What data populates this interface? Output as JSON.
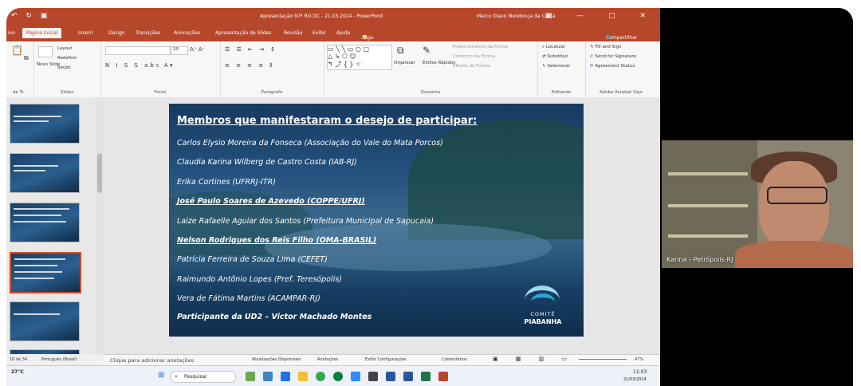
{
  "window": {
    "title": "Apresentação 97ª RO DC - 21.03.2024 - PowerPoint",
    "user": "Marco Olavo Mendonça da Costa",
    "search_hint": "Diga-me o que você deseja fazer",
    "share": "Compartilhar"
  },
  "tabs": [
    "ivo",
    "Página Inicial",
    "Inserir",
    "Design",
    "Transições",
    "Animações",
    "Apresentação de Slides",
    "Revisão",
    "Exibir",
    "Ajuda"
  ],
  "ribbon": {
    "groups": {
      "clipboard": "de Tr...",
      "slides": "Slides",
      "font": "Fonte",
      "paragraph": "Parágrafo",
      "drawing": "Desenho",
      "editing": "Editando",
      "acrobat": "Adobe Acrobat Sign"
    },
    "layout": "Layout",
    "reset": "Redefinir",
    "new_slide": "Novo Slide",
    "section": "Seção",
    "font_size": "20",
    "organize": "Organizar",
    "quick_styles": "Estilos Rápidos",
    "shape_fill": "Preenchimento da Forma",
    "shape_outline": "Contorno da Forma",
    "shape_effects": "Efeitos de Forma",
    "find": "Localizar",
    "replace": "Substituir",
    "select": "Selecionar",
    "fill_sign": "Fill and Sign",
    "send_sig": "Send for Signature",
    "agreement": "Agreement Status"
  },
  "slide": {
    "title": "Membros que manifestaram o desejo de participar:",
    "members": [
      {
        "text": "Carlos Elysio Moreira da Fonseca (Associação do Vale do Mata Porcos)",
        "bold": false,
        "underline": false
      },
      {
        "text": "Claudia Karina Wilberg de Castro Costa (IAB-RJ)",
        "bold": false,
        "underline": false
      },
      {
        "text": "Erika Cortines (UFRRJ-ITR)",
        "bold": false,
        "underline": false
      },
      {
        "text": "José Paulo Soares de Azevedo (COPPE/UFRJ)",
        "bold": true,
        "underline": true
      },
      {
        "text": "Laize Rafaelle Aguiar dos Santos (Prefeitura Municipal de Sapucaia)",
        "bold": false,
        "underline": false
      },
      {
        "text": "Nelson Rodrigues dos Reis Filho (OMA-BRASIL)",
        "bold": true,
        "underline": true
      },
      {
        "text": "Patrícia Ferreira de Souza Lima (CEFET)",
        "bold": false,
        "underline": false
      },
      {
        "text": "Raimundo Antônio Lopes (Pref. Teresópolis)",
        "bold": false,
        "underline": false
      },
      {
        "text": "Vera de Fátima Martins (ACAMPAR-RJ)",
        "bold": false,
        "underline": false
      }
    ],
    "footer": "Participante da UD2 – Victor Machado Montes",
    "logo_top": "COMITÊ",
    "logo_bottom": "PIABANHA"
  },
  "notes_placeholder": "Clique para adicionar anotações",
  "status": {
    "slide_count": "10 de 34",
    "language": "Português (Brasil)",
    "updates": "Atualizações Disponíveis",
    "annotations": "Anotações",
    "view_settings": "Exibir Configurações",
    "comments": "Comentários",
    "zoom": "47%"
  },
  "taskbar": {
    "weather": "27°C",
    "search": "Pesquisar",
    "time": "11:03",
    "date": "21/03/2024"
  },
  "video": {
    "participant": "Karina - Petrópolis-RJ"
  }
}
